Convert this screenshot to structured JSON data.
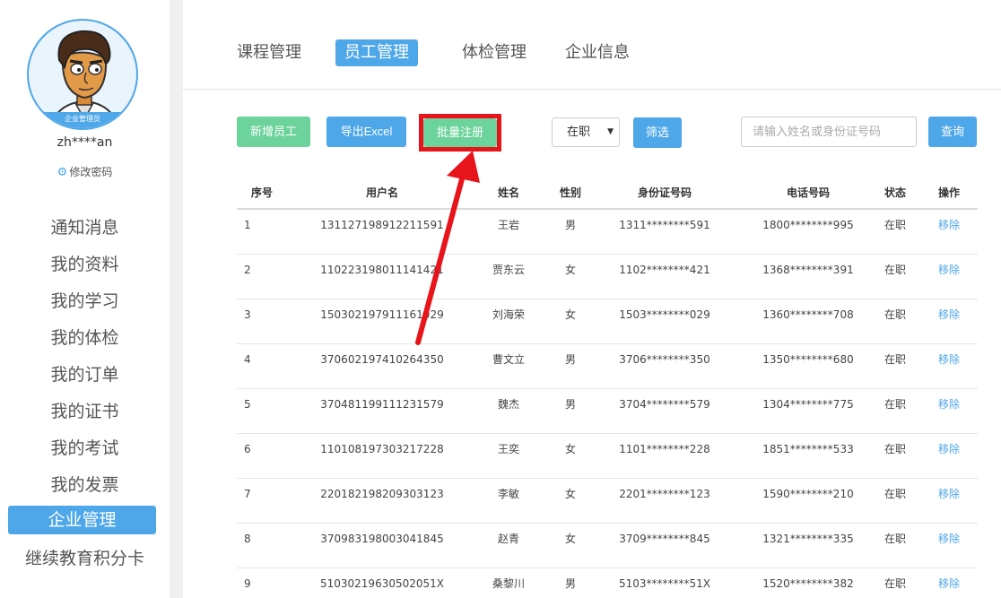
{
  "sidebar": {
    "avatar_badge": "企业管理员",
    "username": "zh****an",
    "change_password": "修改密码",
    "menu": [
      {
        "label": "通知消息",
        "active": false
      },
      {
        "label": "我的资料",
        "active": false
      },
      {
        "label": "我的学习",
        "active": false
      },
      {
        "label": "我的体检",
        "active": false
      },
      {
        "label": "我的订单",
        "active": false
      },
      {
        "label": "我的证书",
        "active": false
      },
      {
        "label": "我的考试",
        "active": false
      },
      {
        "label": "我的发票",
        "active": false
      },
      {
        "label": "企业管理",
        "active": true
      },
      {
        "label": "继续教育积分卡",
        "active": false
      }
    ]
  },
  "tabs": [
    {
      "label": "课程管理",
      "active": false
    },
    {
      "label": "员工管理",
      "active": true
    },
    {
      "label": "体检管理",
      "active": false
    },
    {
      "label": "企业信息",
      "active": false
    }
  ],
  "toolbar": {
    "add_employee": "新增员工",
    "export_excel": "导出Excel",
    "batch_register": "批量注册",
    "status_value": "在职",
    "filter": "筛选",
    "search_placeholder": "请输入姓名或身份证号码",
    "query": "查询"
  },
  "table": {
    "columns": [
      "序号",
      "用户名",
      "姓名",
      "性别",
      "身份证号码",
      "电话号码",
      "状态",
      "操作"
    ],
    "rows": [
      [
        "1",
        "131127198912211591",
        "王岩",
        "男",
        "1311********591",
        "1800********995",
        "在职",
        "移除"
      ],
      [
        "2",
        "110223198011141421",
        "贾东云",
        "女",
        "1102********421",
        "1368********391",
        "在职",
        "移除"
      ],
      [
        "3",
        "150302197911161029",
        "刘海荣",
        "女",
        "1503********029",
        "1360********708",
        "在职",
        "移除"
      ],
      [
        "4",
        "370602197410264350",
        "曹文立",
        "男",
        "3706********350",
        "1350********680",
        "在职",
        "移除"
      ],
      [
        "5",
        "370481199111231579",
        "魏杰",
        "男",
        "3704********579",
        "1304********775",
        "在职",
        "移除"
      ],
      [
        "6",
        "110108197303217228",
        "王奕",
        "女",
        "1101********228",
        "1851********533",
        "在职",
        "移除"
      ],
      [
        "7",
        "220182198209303123",
        "李敏",
        "女",
        "2201********123",
        "1590********210",
        "在职",
        "移除"
      ],
      [
        "8",
        "370983198003041845",
        "赵青",
        "女",
        "3709********845",
        "1321********335",
        "在职",
        "移除"
      ],
      [
        "9",
        "51030219630502051X",
        "桑黎川",
        "男",
        "5103********51X",
        "1520********382",
        "在职",
        "移除"
      ]
    ]
  },
  "colors": {
    "accent": "#4ea7e8",
    "green": "#6dd39c",
    "highlight": "#e8141b"
  }
}
